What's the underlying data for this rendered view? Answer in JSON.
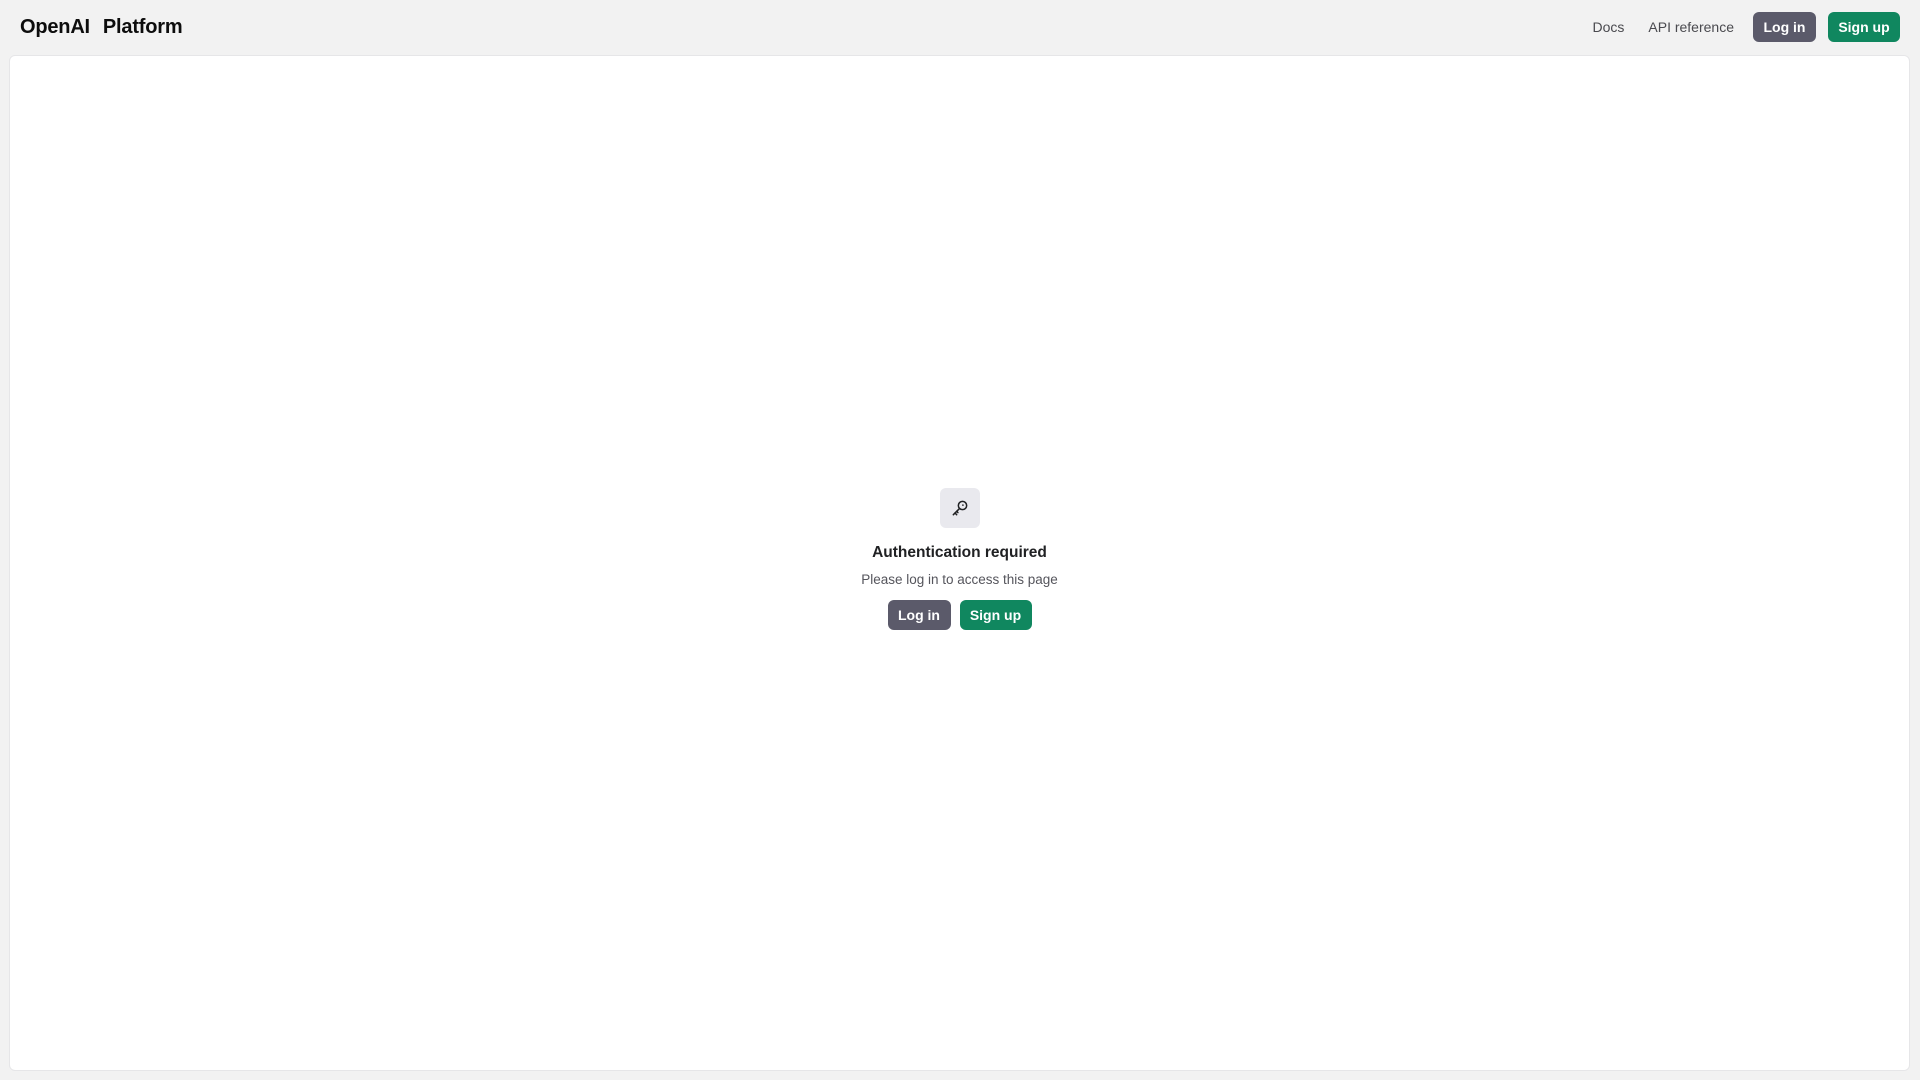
{
  "header": {
    "brand": "OpenAI",
    "product": "Platform",
    "nav": {
      "docs": "Docs",
      "api_reference": "API reference"
    },
    "login_label": "Log in",
    "signup_label": "Sign up"
  },
  "auth": {
    "icon": "key-icon",
    "title": "Authentication required",
    "subtitle": "Please log in to access this page",
    "login_label": "Log in",
    "signup_label": "Sign up"
  },
  "colors": {
    "background": "#f2f2f2",
    "panel": "#ffffff",
    "login_button": "#5b5a6a",
    "signup_button": "#10875f",
    "icon_box": "#e9e9ee"
  }
}
